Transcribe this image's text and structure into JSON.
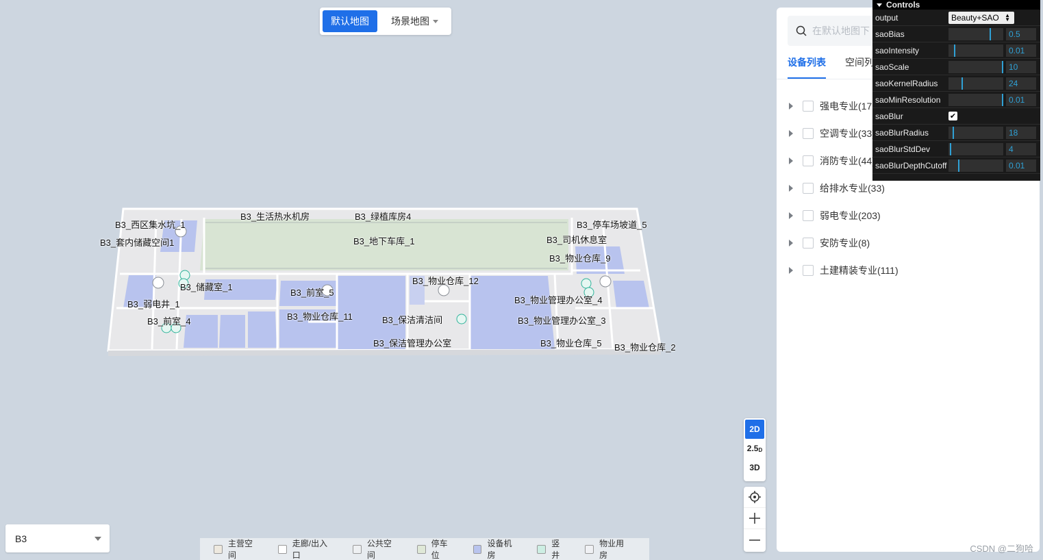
{
  "map_toggle": {
    "default_label": "默认地图",
    "scene_label": "场景地图"
  },
  "rooms": [
    "B3_西区集水坑_1",
    "B3_套内储藏空间1",
    "B3_生活热水机房",
    "B3_绿植库房4",
    "B3_停车场坡道_5",
    "B3_地下车库_1",
    "B3_司机休息室",
    "B3_物业仓库_9",
    "B3_储藏室_1",
    "B3_物业仓库_12",
    "B3_前室_5",
    "B3_弱电井_1",
    "B3_物业管理办公室_4",
    "B3_物业仓库_11",
    "B3_保洁清洁间",
    "B3_前室_4",
    "B3_物业管理办公室_3",
    "B3_保洁管理办公室",
    "B3_物业仓库_5",
    "B3_物业仓库_2"
  ],
  "view_mode": {
    "d2": "2D",
    "d25": "2.5",
    "d25_sub": "D",
    "d3": "3D"
  },
  "floor": {
    "value": "B3"
  },
  "legend": [
    {
      "label": "主营空间",
      "color": "#eee9df"
    },
    {
      "label": "走廊/出入口",
      "color": "#ffffff"
    },
    {
      "label": "公共空间",
      "color": "#eef0f2"
    },
    {
      "label": "停车位",
      "color": "#dfe8d7"
    },
    {
      "label": "设备机房",
      "color": "#b9c4ee"
    },
    {
      "label": "竖井",
      "color": "#cdeee3"
    },
    {
      "label": "物业用房",
      "color": "#f0f1f4"
    }
  ],
  "panel": {
    "search_placeholder": "在默认地图下",
    "tabs": [
      "设备列表",
      "空间列表"
    ],
    "tree": [
      "强电专业(179)",
      "空调专业(33)",
      "消防专业(44)",
      "给排水专业(33)",
      "弱电专业(203)",
      "安防专业(8)",
      "土建精装专业(111)"
    ]
  },
  "controls": {
    "title": "Controls",
    "output_label": "output",
    "output_value": "Beauty+SAO",
    "rows": [
      {
        "label": "saoBias",
        "value": "0.5",
        "level": 0.75
      },
      {
        "label": "saoIntensity",
        "value": "0.01",
        "level": 0.1
      },
      {
        "label": "saoScale",
        "value": "10",
        "level": 1.0
      },
      {
        "label": "saoKernelRadius",
        "value": "24",
        "level": 0.24
      },
      {
        "label": "saoMinResolution",
        "value": "0.01",
        "level": 1.0
      },
      {
        "label": "saoBlurRadius",
        "value": "18",
        "level": 0.08
      },
      {
        "label": "saoBlurStdDev",
        "value": "4",
        "level": 0.02
      },
      {
        "label": "saoBlurDepthCutoff",
        "value": "0.01",
        "level": 0.17
      }
    ],
    "blur_label": "saoBlur",
    "blur_checked": true
  },
  "watermark": "CSDN @二狗哈"
}
